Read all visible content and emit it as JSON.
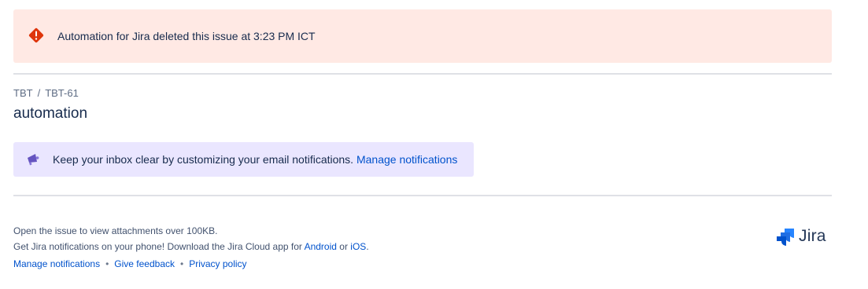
{
  "banner": {
    "icon": "error-diamond-icon",
    "color": "#de350b",
    "message": "Automation for Jira deleted this issue at 3:23 PM ICT"
  },
  "breadcrumb": {
    "project": "TBT",
    "separator": "/",
    "issue_key": "TBT-61"
  },
  "issue": {
    "title": "automation"
  },
  "notice": {
    "icon": "megaphone-icon",
    "text": "Keep your inbox clear by customizing your email notifications.",
    "link_label": "Manage notifications"
  },
  "footer": {
    "attachments_note": "Open the issue to view attachments over 100KB.",
    "app_note_prefix": "Get Jira notifications on your phone! Download the Jira Cloud app for",
    "android_label": "Android",
    "or_label": "or",
    "ios_label": "iOS",
    "period": ".",
    "links": {
      "manage": "Manage notifications",
      "feedback": "Give feedback",
      "privacy": "Privacy policy"
    },
    "dot": "•"
  },
  "brand": {
    "logo_icon": "jira-logo-icon",
    "name": "Jira",
    "accent": "#2684ff"
  }
}
